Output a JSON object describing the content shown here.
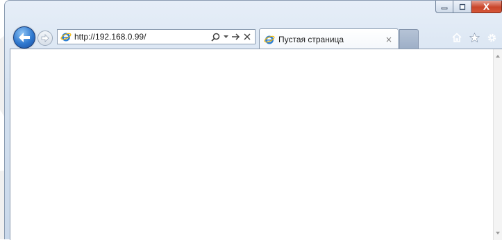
{
  "window": {
    "caption": {
      "minimize_icon": "minimize-icon",
      "maximize_icon": "maximize-icon",
      "close_label": "X"
    },
    "colors": {
      "frame": "#d3e0ef",
      "close_red": "#c9452a",
      "nav_blue": "#2f78cf"
    }
  },
  "nav": {
    "back_icon": "back-arrow-icon",
    "forward_icon": "forward-arrow-icon",
    "address": {
      "favicon": "ie-logo-icon",
      "url": "http://192.168.0.99/",
      "tools": [
        "search-icon",
        "dropdown-icon",
        "go-arrow-icon",
        "stop-icon"
      ]
    }
  },
  "tabs": [
    {
      "favicon": "ie-logo-icon",
      "label": "Пустая страница",
      "close_label": "×"
    }
  ],
  "toolbar_right": [
    "home-icon",
    "favorites-star-icon",
    "settings-gear-icon"
  ]
}
